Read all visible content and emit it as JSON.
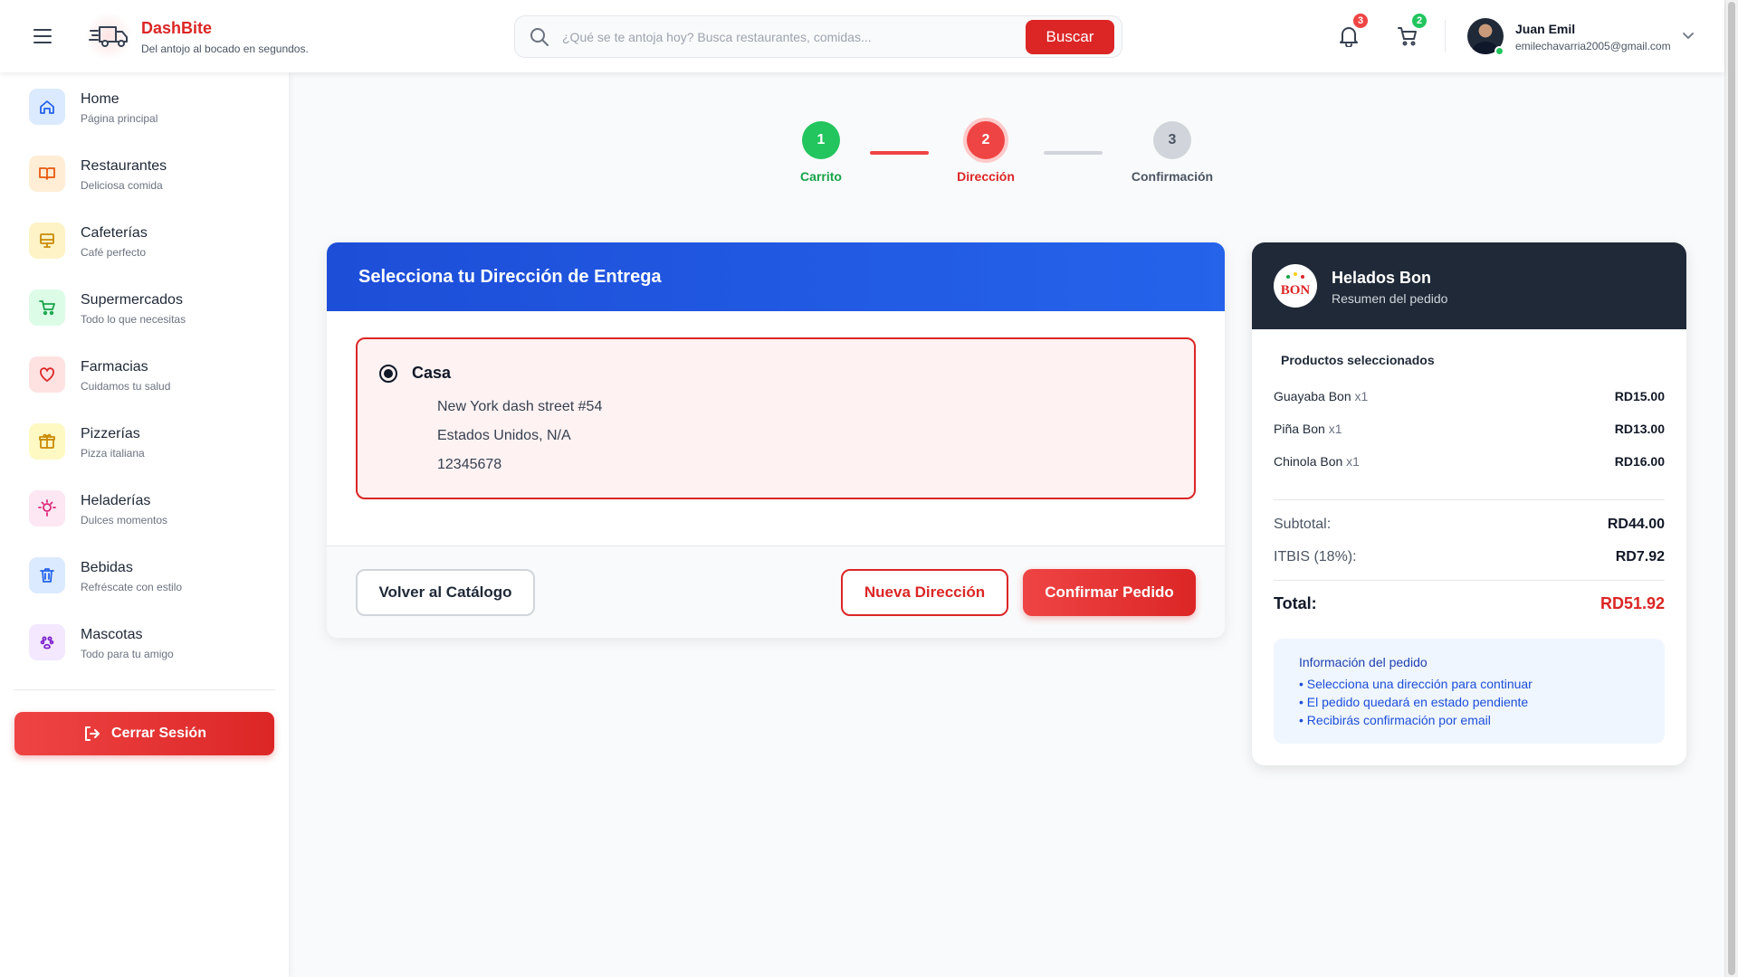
{
  "header": {
    "brand_name": "DashBite",
    "brand_tagline": "Del antojo al bocado en segundos.",
    "search_placeholder": "¿Qué se te antoja hoy? Busca restaurantes, comidas...",
    "search_button": "Buscar",
    "notifications_count": "3",
    "cart_count": "2",
    "user_name": "Juan Emil",
    "user_email": "emilechavarria2005@gmail.com"
  },
  "sidebar": {
    "items": [
      {
        "label": "Home",
        "sub": "Página principal",
        "icon": "home-icon",
        "color": "#2563eb",
        "bg": "#dbeafe"
      },
      {
        "label": "Restaurantes",
        "sub": "Deliciosa comida",
        "icon": "book-icon",
        "color": "#ea580c",
        "bg": "#ffedd5"
      },
      {
        "label": "Cafeterías",
        "sub": "Café perfecto",
        "icon": "monitor-icon",
        "color": "#ca8a04",
        "bg": "#fef3c7"
      },
      {
        "label": "Supermercados",
        "sub": "Todo lo que necesitas",
        "icon": "cart-icon",
        "color": "#16a34a",
        "bg": "#dcfce7"
      },
      {
        "label": "Farmacias",
        "sub": "Cuidamos tu salud",
        "icon": "heart-icon",
        "color": "#dc2626",
        "bg": "#fee2e2"
      },
      {
        "label": "Pizzerías",
        "sub": "Pizza italiana",
        "icon": "gift-icon",
        "color": "#ca8a04",
        "bg": "#fef9c3"
      },
      {
        "label": "Heladerías",
        "sub": "Dulces momentos",
        "icon": "lightbulb-icon",
        "color": "#db2777",
        "bg": "#fce7f3"
      },
      {
        "label": "Bebidas",
        "sub": "Refréscate con estilo",
        "icon": "trash-icon",
        "color": "#2563eb",
        "bg": "#dbeafe"
      },
      {
        "label": "Mascotas",
        "sub": "Todo para tu amigo",
        "icon": "paw-icon",
        "color": "#7e22ce",
        "bg": "#f3e8ff"
      }
    ],
    "logout_label": "Cerrar Sesión"
  },
  "stepper": {
    "steps": [
      {
        "number": "1",
        "label": "Carrito",
        "state": "done"
      },
      {
        "number": "2",
        "label": "Dirección",
        "state": "active"
      },
      {
        "number": "3",
        "label": "Confirmación",
        "state": "pending"
      }
    ]
  },
  "address_card": {
    "title": "Selecciona tu Dirección de Entrega",
    "selected": {
      "name": "Casa",
      "line1": "New York dash street #54",
      "line2": "Estados Unidos, N/A",
      "line3": "12345678"
    },
    "back_button": "Volver al Catálogo",
    "new_address_button": "Nueva Dirección",
    "confirm_button": "Confirmar Pedido"
  },
  "summary": {
    "shop_name": "Helados Bon",
    "shop_sub": "Resumen del pedido",
    "logo_text": "BON",
    "products_heading": "Productos seleccionados",
    "products": [
      {
        "name": "Guayaba Bon",
        "qty": "x1",
        "price": "RD15.00"
      },
      {
        "name": "Piña Bon",
        "qty": "x1",
        "price": "RD13.00"
      },
      {
        "name": "Chinola Bon",
        "qty": "x1",
        "price": "RD16.00"
      }
    ],
    "subtotal_label": "Subtotal:",
    "subtotal_value": "RD44.00",
    "tax_label": "ITBIS (18%):",
    "tax_value": "RD7.92",
    "total_label": "Total:",
    "total_value": "RD51.92",
    "info_title": "Información del pedido",
    "info_items": [
      "• Selecciona una dirección para continuar",
      "• El pedido quedará en estado pendiente",
      "• Recibirás confirmación por email"
    ]
  },
  "colors": {
    "brand_red": "#dc2626",
    "success_green": "#22c55e",
    "header_blue": "#1d4ed8",
    "summary_dark": "#1f2937"
  }
}
